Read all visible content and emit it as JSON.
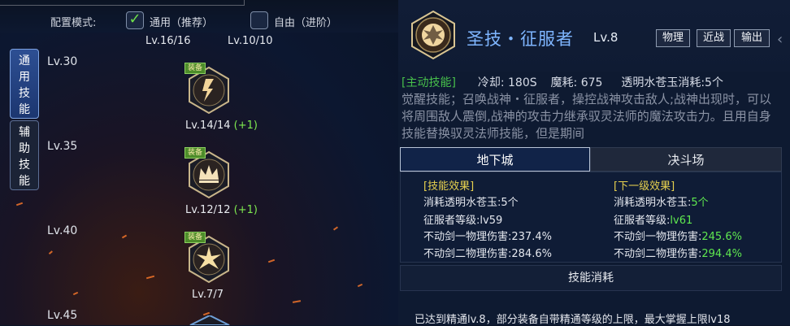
{
  "config": {
    "label": "配置模式:",
    "option_general": "通用（推荐）",
    "option_free": "自由（进阶）",
    "general_count": "Lv.16/16",
    "free_count": "Lv.10/10"
  },
  "side_tabs": {
    "general": "通用技能",
    "auxiliary": "辅助技能"
  },
  "levels": [
    "Lv.30",
    "Lv.35",
    "Lv.40",
    "Lv.45"
  ],
  "skills": [
    {
      "tag": "装备",
      "level": "Lv.14/14",
      "bonus": "(+1)"
    },
    {
      "tag": "装备",
      "level": "Lv.12/12",
      "bonus": "(+1)"
    },
    {
      "tag": "装备",
      "level": "Lv.7/7",
      "bonus": ""
    }
  ],
  "detail": {
    "title": "圣技・征服者",
    "level": "Lv.8",
    "tags": [
      "物理",
      "近战",
      "输出"
    ],
    "active_tag": "[主动技能]",
    "cooldown": "冷却: 180S",
    "mana": "魔耗: 675",
    "cost": "透明水苍玉消耗:5个",
    "description": "觉醒技能；召唤战神・征服者，操控战神攻击敌人;战神出现时，可以将周围敌人震倒,战神的攻击力继承驭灵法师的魔法攻击力。且用自身技能替换驭灵法师技能，但是期间",
    "tabs": [
      "地下城",
      "决斗场"
    ],
    "current_head": "[技能效果]",
    "next_head": "[下一级效果]",
    "current": {
      "l1_label": "消耗透明水苍玉:",
      "l1_value": "5个",
      "l2_label": "征服者等级:",
      "l2_value": "lv59",
      "l3_label": "不动剑一物理伤害:",
      "l3_value": "237.4%",
      "l4_label": "不动剑二物理伤害:",
      "l4_value": "284.6%"
    },
    "next": {
      "l1_label": "消耗透明水苍玉:",
      "l1_value": "5个",
      "l2_label": "征服者等级:",
      "l2_value": "lv61",
      "l3_label": "不动剑一物理伤害:",
      "l3_value": "245.6%",
      "l4_label": "不动剑二物理伤害:",
      "l4_value": "294.4%"
    },
    "consume_title": "技能消耗",
    "mastery_note": "已达到精通lv.8，部分装备自带精通等级的上限，最大掌握上限lv18"
  },
  "colors": {
    "accent_blue": "#7fb6ff",
    "green": "#5fe84f",
    "yellow": "#e8d24f"
  },
  "icons": [
    "check-icon",
    "conqueror-skill-icon",
    "sword-rune-icon",
    "crown-icon",
    "burst-icon",
    "chevron-right-icon"
  ]
}
